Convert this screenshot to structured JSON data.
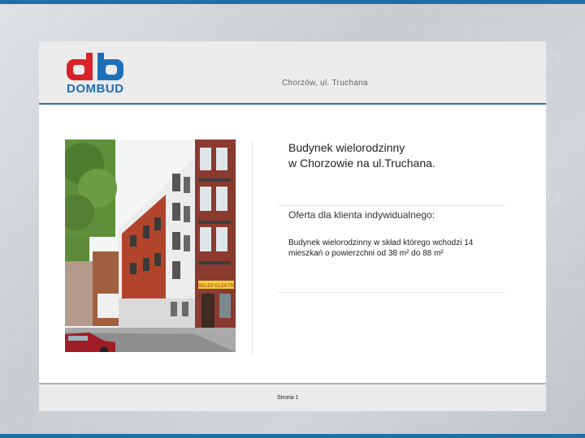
{
  "header": {
    "logo_text": "DOMBUD",
    "address": "Chorzów, ul. Truchana"
  },
  "content": {
    "title_line1": "Budynek wielorodzinny",
    "title_line2": "w Chorzowie na ul.Truchana.",
    "subtitle": "Oferta dla klienta indywidualnego:",
    "description": "Budynek wielorodzinny w skład którego wchodzi 14 mieszkań o powierzchni od 38 m² do 88 m²",
    "photo_sign": "SKLEP ELEKTR"
  },
  "footer": {
    "page_label": "Strona 1"
  },
  "colors": {
    "accent": "#1f6fa9",
    "logo_red": "#d9222a",
    "logo_blue": "#1d6fb8"
  }
}
